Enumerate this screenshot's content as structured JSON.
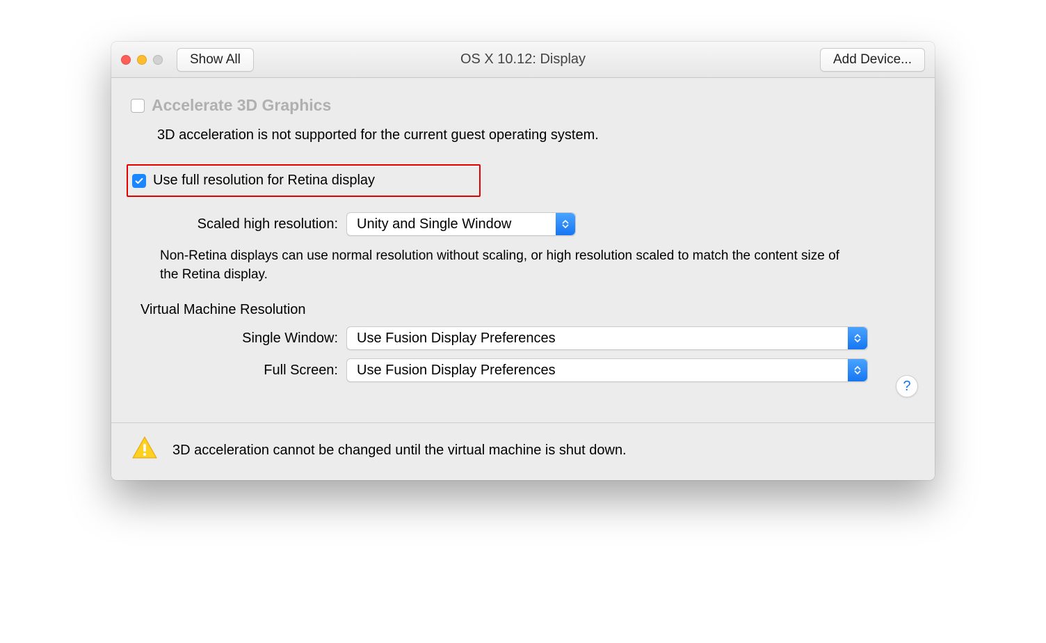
{
  "titlebar": {
    "show_all": "Show All",
    "title": "OS X 10.12: Display",
    "add_device": "Add Device..."
  },
  "accelerate": {
    "label": "Accelerate 3D Graphics",
    "desc": "3D acceleration is not supported for the current guest operating system."
  },
  "retina": {
    "label": "Use full resolution for Retina display"
  },
  "scaled": {
    "label": "Scaled high resolution:",
    "value": "Unity and Single Window",
    "desc": "Non-Retina displays can use normal resolution without scaling, or high resolution scaled to match the content size of the Retina display."
  },
  "vm_res": {
    "heading": "Virtual Machine Resolution",
    "single_label": "Single Window:",
    "single_value": "Use Fusion Display Preferences",
    "full_label": "Full Screen:",
    "full_value": "Use Fusion Display Preferences"
  },
  "help": "?",
  "footer": {
    "text": "3D acceleration cannot be changed until the virtual machine is shut down."
  }
}
